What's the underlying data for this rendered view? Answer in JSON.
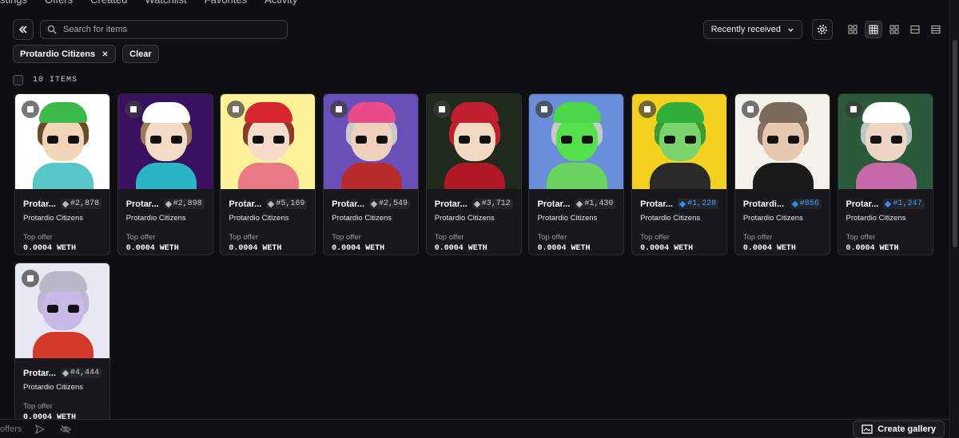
{
  "top_tabs": [
    "stings",
    "Offers",
    "Created",
    "Watchlist",
    "Favorites",
    "Activity"
  ],
  "toolbar": {
    "collapse_icon": "double-chevron-left-icon",
    "search_placeholder": "Search for items",
    "sort_label": "Recently received",
    "view_modes": [
      "grid-large",
      "grid-medium",
      "grid-small",
      "list",
      "table"
    ],
    "active_view": 1
  },
  "filters": {
    "chip_label": "Protardio Citizens",
    "clear_label": "Clear"
  },
  "count_label": "10 ITEMS",
  "items": [
    {
      "name": "Protar...",
      "token": "#2,878",
      "collection": "Protardio Citizens",
      "offer_label": "Top offer",
      "offer": "0.0004 WETH",
      "verified": false,
      "bg": "#ffffff",
      "accent": "#c91f2a",
      "cap": "#3cba4a",
      "hair": "#6b4a2a",
      "skin": "#f3d6b8",
      "body": "#58c7c9"
    },
    {
      "name": "Protar...",
      "token": "#2,898",
      "collection": "Protardio Citizens",
      "offer_label": "Top offer",
      "offer": "0.0004 WETH",
      "verified": false,
      "bg": "#3a1060",
      "accent": "#8b2cc9",
      "cap": "#ffffff",
      "hair": "#9b7a5a",
      "skin": "#f5dcc6",
      "body": "#2ab4c6"
    },
    {
      "name": "Protar...",
      "token": "#5,169",
      "collection": "Protardio Citizens",
      "offer_label": "Top offer",
      "offer": "0.0004 WETH",
      "verified": false,
      "bg": "#fdf29a",
      "accent": "#f2d86b",
      "cap": "#d8262e",
      "hair": "#8a3a2a",
      "skin": "#f7dcca",
      "body": "#e87a86"
    },
    {
      "name": "Protar...",
      "token": "#2,549",
      "collection": "Protardio Citizens",
      "offer_label": "Top offer",
      "offer": "0.0004 WETH",
      "verified": false,
      "bg": "#6b4fb8",
      "accent": "#e9c07a",
      "cap": "#e84c8a",
      "hair": "#c9c9c9",
      "skin": "#eed0bd",
      "body": "#b92a2a"
    },
    {
      "name": "Protar...",
      "token": "#3,712",
      "collection": "Protardio Citizens",
      "offer_label": "Top offer",
      "offer": "0.0004 WETH",
      "verified": false,
      "bg": "#1f2a1c",
      "accent": "#3a3a2a",
      "cap": "#c0202e",
      "hair": "#c0202e",
      "skin": "#f2d9c4",
      "body": "#b01826"
    },
    {
      "name": "Protar...",
      "token": "#1,430",
      "collection": "Protardio Citizens",
      "offer_label": "Top offer",
      "offer": "0.0004 WETH",
      "verified": false,
      "bg": "#6a8fd8",
      "accent": "#e95aa8",
      "cap": "#4ad84a",
      "hair": "#c8c8c8",
      "skin": "#54e04a",
      "body": "#6ad25e"
    },
    {
      "name": "Protar...",
      "token": "#1,228",
      "collection": "Protardio Citizens",
      "offer_label": "Top offer",
      "offer": "0.0004 WETH",
      "verified": true,
      "bg": "#f2d21e",
      "accent": "#f08a1a",
      "cap": "#2fae3a",
      "hair": "#3a9a3a",
      "skin": "#7ad46a",
      "body": "#2a2a2a"
    },
    {
      "name": "Protardi...",
      "token": "#856",
      "collection": "Protardio Citizens",
      "offer_label": "Top offer",
      "offer": "0.0004 WETH",
      "verified": true,
      "bg": "#f4f0ea",
      "accent": "#e3a2c8",
      "cap": "#7a6a5a",
      "hair": "#8a7060",
      "skin": "#e9c8b0",
      "body": "#1a1a1a"
    },
    {
      "name": "Protar...",
      "token": "#1,247",
      "collection": "Protardio Citizens",
      "offer_label": "Top offer",
      "offer": "0.0004 WETH",
      "verified": true,
      "bg": "#2b5a3a",
      "accent": "#d43a2a",
      "cap": "#ffffff",
      "hair": "#b8c6c8",
      "skin": "#eed6c6",
      "body": "#c46aa8"
    },
    {
      "name": "Protar...",
      "token": "#4,444",
      "collection": "Protardio Citizens",
      "offer_label": "Top offer",
      "offer": "0.0004 WETH",
      "verified": false,
      "bg": "#e6e8f4",
      "accent": "#2a3ac9",
      "cap": "#b8b8c8",
      "hair": "#bfb6d8",
      "skin": "#c9b8e8",
      "body": "#d43a2a"
    }
  ],
  "bottom": {
    "offers_label": "offers",
    "create_label": "Create gallery"
  }
}
